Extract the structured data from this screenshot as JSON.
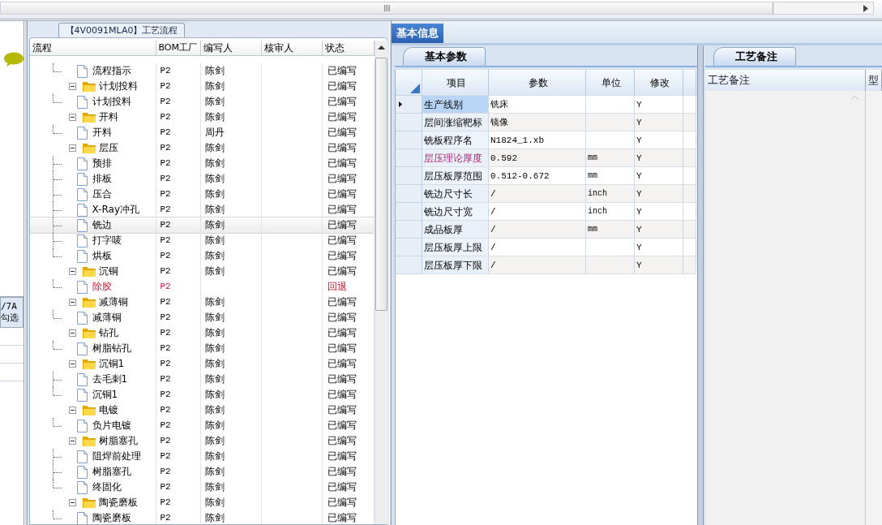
{
  "left_strip": {
    "tab_lines": [
      "/7A",
      "勾选"
    ]
  },
  "flow_panel": {
    "title": "【4V0091MLA0】工艺流程",
    "columns": [
      "流程",
      "BOM工厂",
      "编写人",
      "核审人",
      "状态"
    ],
    "tree": [
      {
        "children": [
          {
            "name": "流程指示",
            "bom": "P2",
            "author": "陈剑",
            "status": "已编写",
            "returned": false,
            "selected": false
          }
        ]
      },
      {
        "name": "计划投料",
        "bom": "P2",
        "author": "陈剑",
        "status": "已编写",
        "returned": false,
        "selected": false,
        "expanded": true,
        "children": [
          {
            "name": "计划投料",
            "bom": "P2",
            "author": "陈剑",
            "status": "已编写",
            "returned": false,
            "selected": false
          }
        ]
      },
      {
        "name": "开料",
        "bom": "P2",
        "author": "陈剑",
        "status": "已编写",
        "returned": false,
        "selected": false,
        "expanded": true,
        "children": [
          {
            "name": "开料",
            "bom": "P2",
            "author": "周丹",
            "status": "已编写",
            "returned": false,
            "selected": false
          }
        ]
      },
      {
        "name": "层压",
        "bom": "P2",
        "author": "陈剑",
        "status": "已编写",
        "returned": false,
        "selected": false,
        "expanded": true,
        "children": [
          {
            "name": "预排",
            "bom": "P2",
            "author": "陈剑",
            "status": "已编写",
            "returned": false,
            "selected": false
          },
          {
            "name": "排板",
            "bom": "P2",
            "author": "陈剑",
            "status": "已编写",
            "returned": false,
            "selected": false
          },
          {
            "name": "压合",
            "bom": "P2",
            "author": "陈剑",
            "status": "已编写",
            "returned": false,
            "selected": false
          },
          {
            "name": "X-Ray冲孔",
            "bom": "P2",
            "author": "陈剑",
            "status": "已编写",
            "returned": false,
            "selected": false
          },
          {
            "name": "铣边",
            "bom": "P2",
            "author": "陈剑",
            "status": "已编写",
            "returned": false,
            "selected": true
          },
          {
            "name": "打字唛",
            "bom": "P2",
            "author": "陈剑",
            "status": "已编写",
            "returned": false,
            "selected": false
          },
          {
            "name": "烘板",
            "bom": "P2",
            "author": "陈剑",
            "status": "已编写",
            "returned": false,
            "selected": false
          }
        ]
      },
      {
        "name": "沉铜",
        "bom": "P2",
        "author": "陈剑",
        "status": "已编写",
        "returned": false,
        "selected": false,
        "expanded": true,
        "children": [
          {
            "name": "除胶",
            "bom": "P2",
            "status": "回退",
            "returned": true,
            "selected": false
          }
        ]
      },
      {
        "name": "减薄铜",
        "bom": "P2",
        "author": "陈剑",
        "status": "已编写",
        "returned": false,
        "selected": false,
        "expanded": true,
        "children": [
          {
            "name": "减薄铜",
            "bom": "P2",
            "author": "陈剑",
            "status": "已编写",
            "returned": false,
            "selected": false
          }
        ]
      },
      {
        "name": "钻孔",
        "bom": "P2",
        "author": "陈剑",
        "status": "已编写",
        "returned": false,
        "selected": false,
        "expanded": true,
        "children": [
          {
            "name": "树脂钻孔",
            "bom": "P2",
            "author": "陈剑",
            "status": "已编写",
            "returned": false,
            "selected": false
          }
        ]
      },
      {
        "name": "沉铜1",
        "bom": "P2",
        "author": "陈剑",
        "status": "已编写",
        "returned": false,
        "selected": false,
        "expanded": true,
        "children": [
          {
            "name": "去毛刺1",
            "bom": "P2",
            "author": "陈剑",
            "status": "已编写",
            "returned": false,
            "selected": false
          },
          {
            "name": "沉铜1",
            "bom": "P2",
            "author": "陈剑",
            "status": "已编写",
            "returned": false,
            "selected": false
          }
        ]
      },
      {
        "name": "电镀",
        "bom": "P2",
        "author": "陈剑",
        "status": "已编写",
        "returned": false,
        "selected": false,
        "expanded": true,
        "children": [
          {
            "name": "负片电镀",
            "bom": "P2",
            "author": "陈剑",
            "status": "已编写",
            "returned": false,
            "selected": false
          }
        ]
      },
      {
        "name": "树脂塞孔",
        "bom": "P2",
        "author": "陈剑",
        "status": "已编写",
        "returned": false,
        "selected": false,
        "expanded": true,
        "children": [
          {
            "name": "阻焊前处理",
            "bom": "P2",
            "author": "陈剑",
            "status": "已编写",
            "returned": false,
            "selected": false
          },
          {
            "name": "树脂塞孔",
            "bom": "P2",
            "author": "陈剑",
            "status": "已编写",
            "returned": false,
            "selected": false
          },
          {
            "name": "终固化",
            "bom": "P2",
            "author": "陈剑",
            "status": "已编写",
            "returned": false,
            "selected": false
          }
        ]
      },
      {
        "name": "陶瓷磨板",
        "bom": "P2",
        "author": "陈剑",
        "status": "已编写",
        "returned": false,
        "selected": false,
        "expanded": true,
        "children": [
          {
            "name": "陶瓷磨板",
            "bom": "P2",
            "author": "陈剑",
            "status": "已编写",
            "returned": false,
            "selected": false
          }
        ]
      }
    ]
  },
  "info_tabs": [
    {
      "label": "基本信息",
      "selected": true
    }
  ],
  "params": {
    "tab": {
      "label": "基本参数",
      "selected": true
    },
    "columns": [
      "项目",
      "参数",
      "单位",
      "修改"
    ],
    "rows": [
      {
        "item": "生产线别",
        "value": "铣床",
        "unit": "",
        "modify": "Y",
        "selected": true,
        "highlighted": false
      },
      {
        "item": "层间涨缩靶标",
        "value": "镜像",
        "unit": "",
        "modify": "Y",
        "selected": false,
        "highlighted": false
      },
      {
        "item": "铣板程序名",
        "value": "N1824_1.xb",
        "unit": "",
        "modify": "Y",
        "selected": false,
        "highlighted": false
      },
      {
        "item": "层压理论厚度",
        "value": "0.592",
        "unit": "mm",
        "modify": "Y",
        "selected": false,
        "highlighted": true
      },
      {
        "item": "层压板厚范围",
        "value": "0.512-0.672",
        "unit": "mm",
        "modify": "Y",
        "selected": false,
        "highlighted": false
      },
      {
        "item": "铣边尺寸长",
        "value": "/",
        "unit": "inch",
        "modify": "Y",
        "selected": false,
        "highlighted": false
      },
      {
        "item": "铣边尺寸宽",
        "value": "/",
        "unit": "inch",
        "modify": "Y",
        "selected": false,
        "highlighted": false
      },
      {
        "item": "成品板厚",
        "value": "/",
        "unit": "mm",
        "modify": "Y",
        "selected": false,
        "highlighted": false
      },
      {
        "item": "层压板厚上限",
        "value": "/",
        "unit": "",
        "modify": "Y",
        "selected": false,
        "highlighted": false
      },
      {
        "item": "层压板厚下限",
        "value": "/",
        "unit": "",
        "modify": "Y",
        "selected": false,
        "highlighted": false
      }
    ]
  },
  "notes": {
    "tab": {
      "label": "工艺备注",
      "selected": true
    },
    "columns": [
      "工艺备注",
      "型"
    ]
  }
}
